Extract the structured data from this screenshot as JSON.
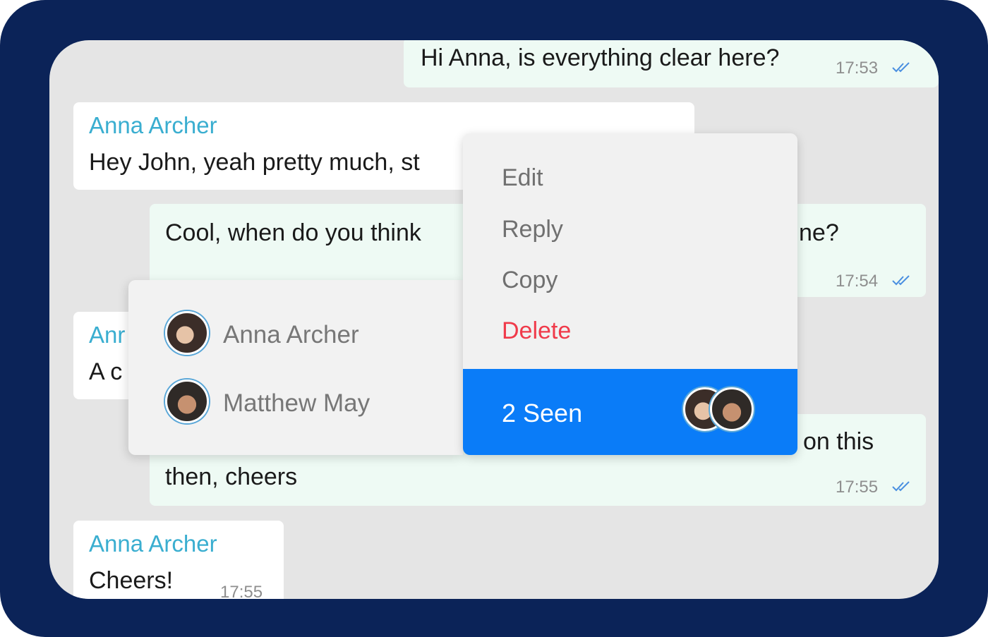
{
  "messages": [
    {
      "id": "m1",
      "direction": "out",
      "text": "Hi Anna, is everything clear here?",
      "time": "17:53",
      "read": true
    },
    {
      "id": "m2",
      "direction": "in",
      "sender": "Anna Archer",
      "text": "Hey John, yeah pretty much, st"
    },
    {
      "id": "m3",
      "direction": "out",
      "text_left": "Cool, when do you think",
      "text_right": "ne?",
      "time": "17:54",
      "read": true
    },
    {
      "id": "m4",
      "direction": "in",
      "sender": "Anr",
      "text": "A c"
    },
    {
      "id": "m5",
      "direction": "out",
      "text_right": "on this",
      "text_line2": "then, cheers",
      "time": "17:55",
      "read": true
    },
    {
      "id": "m6",
      "direction": "in",
      "sender": "Anna Archer",
      "text": "Cheers!",
      "time": "17:55"
    }
  ],
  "context_menu": {
    "items": [
      {
        "label": "Edit"
      },
      {
        "label": "Reply"
      },
      {
        "label": "Copy"
      },
      {
        "label": "Delete",
        "danger": true
      }
    ],
    "seen_label": "2 Seen"
  },
  "seen_by": [
    {
      "name": "Anna Archer",
      "avatar": "anna-avatar"
    },
    {
      "name": "Matthew May",
      "avatar": "matthew-avatar"
    }
  ],
  "colors": {
    "frame": "#0b2358",
    "chat_bg": "#e5e5e5",
    "outgoing_bubble": "#eefaf4",
    "incoming_bubble": "#ffffff",
    "sender_name": "#3aaed0",
    "delete": "#f03a4a",
    "seen_bar": "#0a7cf8",
    "read_check": "#4a8fe0"
  },
  "icons": [
    "double-check-icon"
  ]
}
